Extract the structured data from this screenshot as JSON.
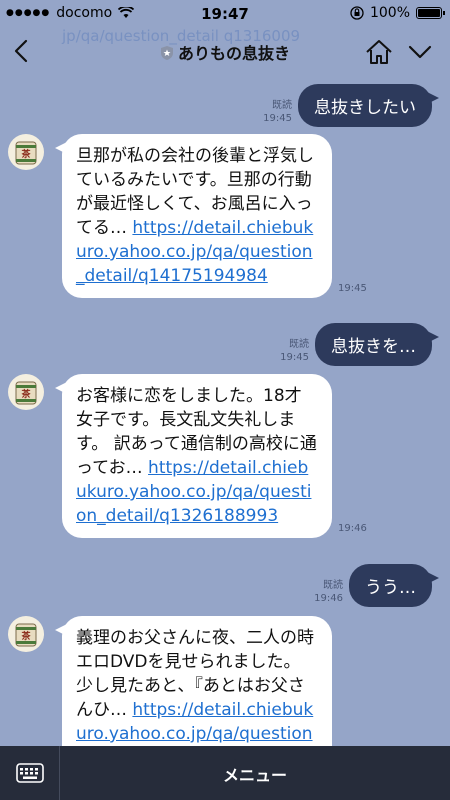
{
  "status": {
    "carrier": "docomo",
    "time": "19:47",
    "battery": "100%"
  },
  "header": {
    "title": "ありもの息抜き",
    "ghost_text": "jp/qa/question_detail q1316009"
  },
  "messages": [
    {
      "type": "out",
      "read": "既読",
      "time": "19:45",
      "text": "息抜きしたい"
    },
    {
      "type": "in",
      "time": "19:45",
      "text": "旦那が私の会社の後輩と浮気しているみたいです。旦那の行動が最近怪しくて、お風呂に入ってる…  ",
      "link": "https://detail.chiebukuro.yahoo.co.jp/qa/question_detail/q14175194984"
    },
    {
      "type": "out",
      "read": "既読",
      "time": "19:45",
      "text": "息抜きを…"
    },
    {
      "type": "in",
      "time": "19:46",
      "text": "お客様に恋をしました。18才女子です。長文乱文失礼します。 訳あって通信制の高校に通ってお…  ",
      "link": "https://detail.chiebukuro.yahoo.co.jp/qa/question_detail/q1326188993"
    },
    {
      "type": "out",
      "read": "既読",
      "time": "19:46",
      "text": "うう…"
    },
    {
      "type": "in",
      "time": "",
      "text": "義理のお父さんに夜、二人の時エロDVDを見せられました。 少し見たあと、『あとはお父さんひ…  ",
      "link": "https://detail.chiebukuro.yahoo.co.jp/qa/question_detail/"
    }
  ],
  "avatar_icon": "tea-cup-icon",
  "bottom": {
    "menu_label": "メニュー"
  },
  "colors": {
    "background": "#95a5c8",
    "bubble_out": "#2d3a5c",
    "link": "#1e6fd0",
    "bottom_bar": "#262c3a"
  }
}
